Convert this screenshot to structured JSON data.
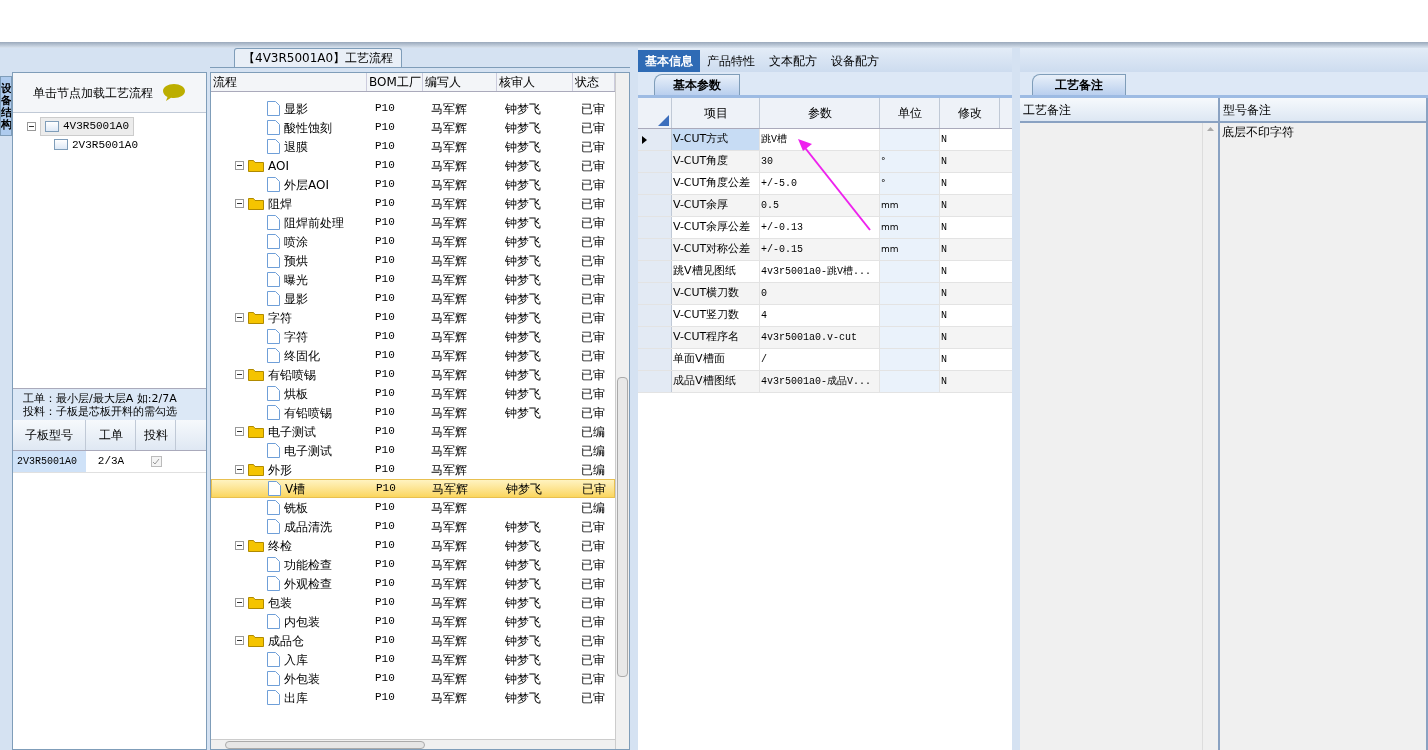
{
  "side_tab": {
    "label": "设备结构"
  },
  "left_panel": {
    "header": "单击节点加载工艺流程",
    "tree": [
      {
        "label": "4V3R5001A0",
        "selected": true,
        "expanded": true,
        "children": [
          {
            "label": "2V3R5001A0",
            "selected": false
          }
        ]
      }
    ],
    "hint_lines": [
      "工单：最小层/最大层A 如:2/7A",
      "投料：子板是芯板开料的需勾选"
    ],
    "grid": {
      "columns": [
        "子板型号",
        "工单",
        "投料"
      ],
      "rows": [
        {
          "model": "2V3R5001A0",
          "order": "2/3A",
          "checked": true
        }
      ]
    }
  },
  "flow_panel": {
    "title": "【4V3R5001A0】工艺流程",
    "columns": [
      "流程",
      "BOM工厂",
      "编写人",
      "核审人",
      "状态"
    ],
    "rows": [
      {
        "children": [
          {
            "label": "显影",
            "factory": "P10",
            "writer": "马军辉",
            "reviewer": "钟梦飞",
            "status": "已审",
            "selected": false
          },
          {
            "label": "酸性蚀刻",
            "factory": "P10",
            "writer": "马军辉",
            "reviewer": "钟梦飞",
            "status": "已审",
            "selected": false
          },
          {
            "label": "退膜",
            "factory": "P10",
            "writer": "马军辉",
            "reviewer": "钟梦飞",
            "status": "已审",
            "selected": false
          }
        ]
      },
      {
        "label": "AOI",
        "factory": "P10",
        "writer": "马军辉",
        "reviewer": "钟梦飞",
        "status": "已审",
        "expanded": true,
        "children": [
          {
            "label": "外层AOI",
            "factory": "P10",
            "writer": "马军辉",
            "reviewer": "钟梦飞",
            "status": "已审",
            "selected": false
          }
        ]
      },
      {
        "label": "阻焊",
        "factory": "P10",
        "writer": "马军辉",
        "reviewer": "钟梦飞",
        "status": "已审",
        "expanded": true,
        "children": [
          {
            "label": "阻焊前处理",
            "factory": "P10",
            "writer": "马军辉",
            "reviewer": "钟梦飞",
            "status": "已审",
            "selected": false
          },
          {
            "label": "喷涂",
            "factory": "P10",
            "writer": "马军辉",
            "reviewer": "钟梦飞",
            "status": "已审",
            "selected": false
          },
          {
            "label": "预烘",
            "factory": "P10",
            "writer": "马军辉",
            "reviewer": "钟梦飞",
            "status": "已审",
            "selected": false
          },
          {
            "label": "曝光",
            "factory": "P10",
            "writer": "马军辉",
            "reviewer": "钟梦飞",
            "status": "已审",
            "selected": false
          },
          {
            "label": "显影",
            "factory": "P10",
            "writer": "马军辉",
            "reviewer": "钟梦飞",
            "status": "已审",
            "selected": false
          }
        ]
      },
      {
        "label": "字符",
        "factory": "P10",
        "writer": "马军辉",
        "reviewer": "钟梦飞",
        "status": "已审",
        "expanded": true,
        "children": [
          {
            "label": "字符",
            "factory": "P10",
            "writer": "马军辉",
            "reviewer": "钟梦飞",
            "status": "已审",
            "selected": false
          },
          {
            "label": "终固化",
            "factory": "P10",
            "writer": "马军辉",
            "reviewer": "钟梦飞",
            "status": "已审",
            "selected": false
          }
        ]
      },
      {
        "label": "有铅喷锡",
        "factory": "P10",
        "writer": "马军辉",
        "reviewer": "钟梦飞",
        "status": "已审",
        "expanded": true,
        "children": [
          {
            "label": "烘板",
            "factory": "P10",
            "writer": "马军辉",
            "reviewer": "钟梦飞",
            "status": "已审",
            "selected": false
          },
          {
            "label": "有铅喷锡",
            "factory": "P10",
            "writer": "马军辉",
            "reviewer": "钟梦飞",
            "status": "已审",
            "selected": false
          }
        ]
      },
      {
        "label": "电子测试",
        "factory": "P10",
        "writer": "马军辉",
        "status": "已编",
        "expanded": true,
        "children": [
          {
            "label": "电子测试",
            "factory": "P10",
            "writer": "马军辉",
            "status": "已编",
            "selected": false
          }
        ]
      },
      {
        "label": "外形",
        "factory": "P10",
        "writer": "马军辉",
        "status": "已编",
        "expanded": true,
        "children": [
          {
            "label": "V槽",
            "factory": "P10",
            "writer": "马军辉",
            "reviewer": "钟梦飞",
            "status": "已审",
            "selected": true
          },
          {
            "label": "铣板",
            "factory": "P10",
            "writer": "马军辉",
            "status": "已编",
            "selected": false
          },
          {
            "label": "成品清洗",
            "factory": "P10",
            "writer": "马军辉",
            "reviewer": "钟梦飞",
            "status": "已审",
            "selected": false
          }
        ]
      },
      {
        "label": "终检",
        "factory": "P10",
        "writer": "马军辉",
        "reviewer": "钟梦飞",
        "status": "已审",
        "expanded": true,
        "children": [
          {
            "label": "功能检查",
            "factory": "P10",
            "writer": "马军辉",
            "reviewer": "钟梦飞",
            "status": "已审",
            "selected": false
          },
          {
            "label": "外观检查",
            "factory": "P10",
            "writer": "马军辉",
            "reviewer": "钟梦飞",
            "status": "已审",
            "selected": false
          }
        ]
      },
      {
        "label": "包装",
        "factory": "P10",
        "writer": "马军辉",
        "reviewer": "钟梦飞",
        "status": "已审",
        "expanded": true,
        "children": [
          {
            "label": "内包装",
            "factory": "P10",
            "writer": "马军辉",
            "reviewer": "钟梦飞",
            "status": "已审",
            "selected": false
          }
        ]
      },
      {
        "label": "成品仓",
        "factory": "P10",
        "writer": "马军辉",
        "reviewer": "钟梦飞",
        "status": "已审",
        "expanded": true,
        "children": [
          {
            "label": "入库",
            "factory": "P10",
            "writer": "马军辉",
            "reviewer": "钟梦飞",
            "status": "已审",
            "selected": false
          },
          {
            "label": "外包装",
            "factory": "P10",
            "writer": "马军辉",
            "reviewer": "钟梦飞",
            "status": "已审",
            "selected": false
          },
          {
            "label": "出库",
            "factory": "P10",
            "writer": "马军辉",
            "reviewer": "钟梦飞",
            "status": "已审",
            "selected": false
          }
        ]
      }
    ]
  },
  "tabs": [
    {
      "label": "基本信息",
      "selected": true
    },
    {
      "label": "产品特性",
      "selected": false
    },
    {
      "label": "文本配方",
      "selected": false
    },
    {
      "label": "设备配方",
      "selected": false
    }
  ],
  "params": {
    "subtab": "基本参数",
    "columns": [
      "项目",
      "参数",
      "单位",
      "修改"
    ],
    "rows": [
      {
        "item": "V-CUT方式",
        "value": "跳V槽",
        "modified": "N",
        "selected": true
      },
      {
        "item": "V-CUT角度",
        "value": "30",
        "unit": "°",
        "modified": "N",
        "selected": false
      },
      {
        "item": "V-CUT角度公差",
        "value": "+/-5.0",
        "unit": "°",
        "modified": "N",
        "selected": false
      },
      {
        "item": "V-CUT余厚",
        "value": "0.5",
        "unit": "mm",
        "modified": "N",
        "selected": false
      },
      {
        "item": "V-CUT余厚公差",
        "value": "+/-0.13",
        "unit": "mm",
        "modified": "N",
        "selected": false
      },
      {
        "item": "V-CUT对称公差",
        "value": "+/-0.15",
        "unit": "mm",
        "modified": "N",
        "selected": false
      },
      {
        "item": "跳V槽见图纸",
        "value": "4v3r5001a0-跳V槽...",
        "modified": "N",
        "selected": false
      },
      {
        "item": "V-CUT横刀数",
        "value": "0",
        "modified": "N",
        "selected": false
      },
      {
        "item": "V-CUT竖刀数",
        "value": "4",
        "modified": "N",
        "selected": false
      },
      {
        "item": "V-CUT程序名",
        "value": "4v3r5001a0.v-cut",
        "modified": "N",
        "selected": false
      },
      {
        "item": "单面V槽面",
        "value": "/",
        "modified": "N",
        "selected": false
      },
      {
        "item": "成品V槽图纸",
        "value": "4v3r5001a0-成品V...",
        "modified": "N",
        "selected": false
      }
    ]
  },
  "notes": {
    "subtab": "工艺备注",
    "columns": [
      {
        "header": "工艺备注"
      },
      {
        "header": "型号备注",
        "text": "底层不印字符"
      }
    ]
  }
}
